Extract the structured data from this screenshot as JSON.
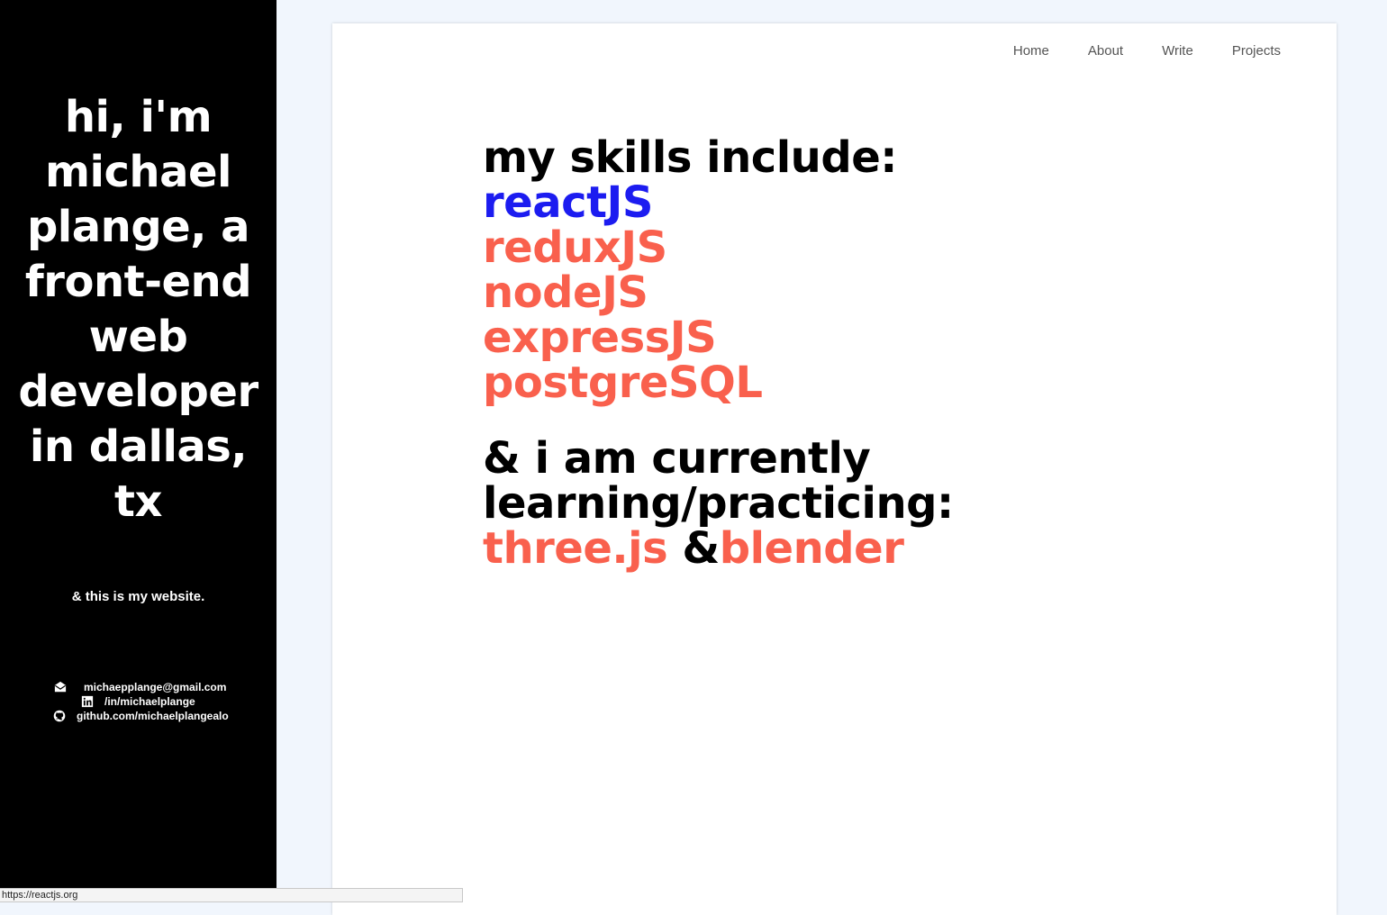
{
  "sidebar": {
    "intro_lines": [
      "hi, i'm",
      "michael",
      "plange, a",
      "front-end",
      "web",
      "developer",
      "in dallas,",
      "tx"
    ],
    "tagline": "& this is my website.",
    "contacts": [
      {
        "icon": "envelope-icon",
        "label": "michaepplange@gmail.com"
      },
      {
        "icon": "linkedin-icon",
        "label": "/in/michaelplange"
      },
      {
        "icon": "github-icon",
        "label": "github.com/michaelplangealo"
      }
    ]
  },
  "nav": {
    "items": [
      "Home",
      "About",
      "Write",
      "Projects"
    ]
  },
  "skills": {
    "heading": "my skills include:",
    "items": [
      "reactJS",
      "reduxJS",
      "nodeJS",
      "expressJS",
      "postgreSQL"
    ],
    "hovered_index": 0
  },
  "learning": {
    "heading_lines": [
      "& i am currently",
      "learning/practicing:"
    ],
    "item1": "three.js",
    "separator": "&",
    "item2": "blender"
  },
  "status_bar": {
    "url": "https://reactjs.org"
  },
  "colors": {
    "sidebar_bg": "#000000",
    "page_bg": "#f1f6fd",
    "skill_color": "#f9604d",
    "hover_color": "#1c1cf0"
  }
}
